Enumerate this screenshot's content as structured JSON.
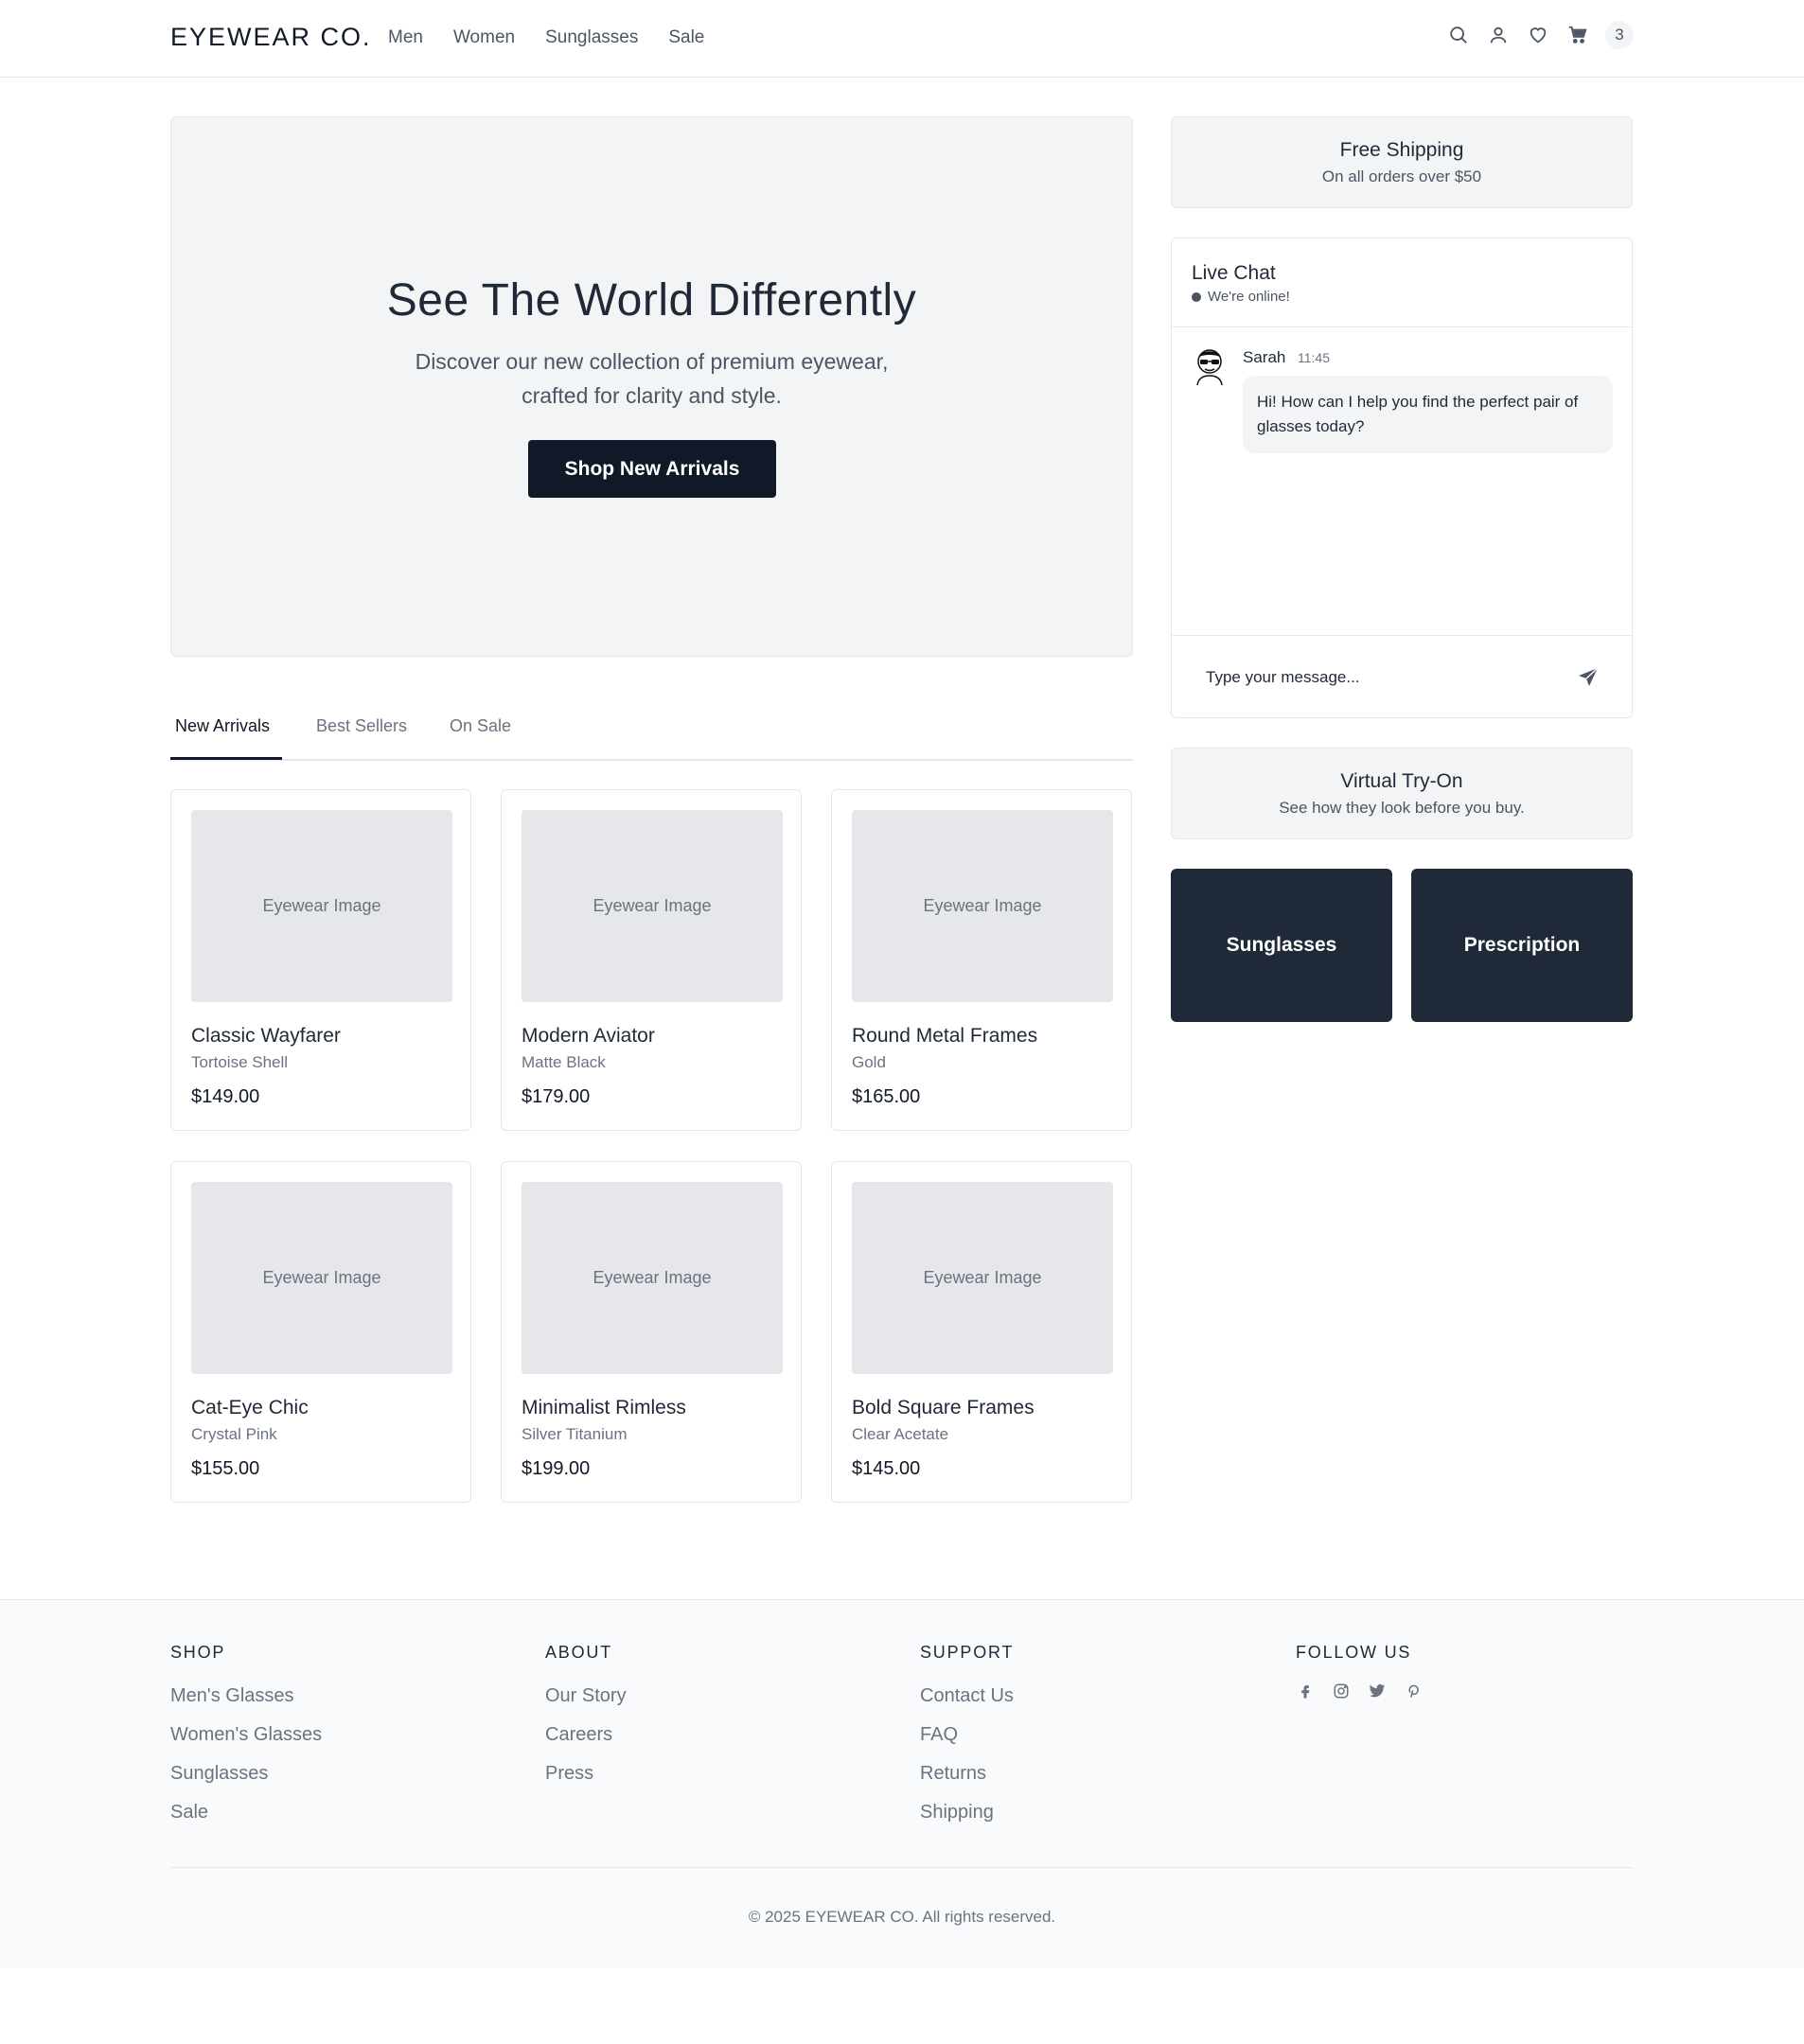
{
  "brand": "EYEWEAR CO.",
  "nav": [
    "Men",
    "Women",
    "Sunglasses",
    "Sale"
  ],
  "header_icons": [
    "search-icon",
    "user-icon",
    "heart-icon",
    "cart-icon"
  ],
  "cart_count": "3",
  "hero": {
    "title": "See The World Differently",
    "subtitle_line1": "Discover our new collection of premium eyewear,",
    "subtitle_line2": "crafted for clarity and style.",
    "cta": "Shop New Arrivals"
  },
  "tabs": [
    "New Arrivals",
    "Best Sellers",
    "On Sale"
  ],
  "active_tab": "New Arrivals",
  "products": [
    {
      "image_label": "Eyewear Image",
      "name": "Classic Wayfarer",
      "variant": "Tortoise Shell",
      "price": "$149.00"
    },
    {
      "image_label": "Eyewear Image",
      "name": "Modern Aviator",
      "variant": "Matte Black",
      "price": "$179.00"
    },
    {
      "image_label": "Eyewear Image",
      "name": "Round Metal Frames",
      "variant": "Gold",
      "price": "$165.00"
    },
    {
      "image_label": "Eyewear Image",
      "name": "Cat-Eye Chic",
      "variant": "Crystal Pink",
      "price": "$155.00"
    },
    {
      "image_label": "Eyewear Image",
      "name": "Minimalist Rimless",
      "variant": "Silver Titanium",
      "price": "$199.00"
    },
    {
      "image_label": "Eyewear Image",
      "name": "Bold Square Frames",
      "variant": "Clear Acetate",
      "price": "$145.00"
    }
  ],
  "free_shipping": {
    "title": "Free Shipping",
    "subtitle": "On all orders over $50"
  },
  "live_chat": {
    "title": "Live Chat",
    "status": "We're online!",
    "message": {
      "sender": "Sarah",
      "time": "11:45 AM",
      "text": "Hi! How can I help you find the perfect pair of glasses today?"
    },
    "input_placeholder": "Type your message..."
  },
  "virtual_tryon": {
    "title": "Virtual Try-On",
    "subtitle": "See how they look before you buy."
  },
  "categories": [
    "Sunglasses",
    "Prescription"
  ],
  "footer": {
    "columns": [
      {
        "heading": "SHOP",
        "links": [
          "Men's Glasses",
          "Women's Glasses",
          "Sunglasses",
          "Sale"
        ]
      },
      {
        "heading": "ABOUT",
        "links": [
          "Our Story",
          "Careers",
          "Press"
        ]
      },
      {
        "heading": "SUPPORT",
        "links": [
          "Contact Us",
          "FAQ",
          "Returns",
          "Shipping"
        ]
      }
    ],
    "follow_heading": "FOLLOW US",
    "social_icons": [
      "facebook-icon",
      "instagram-icon",
      "twitter-icon",
      "pinterest-icon"
    ],
    "copyright": "© 2025 EYEWEAR CO. All rights reserved."
  },
  "colors": {
    "primary_dark": "#111827",
    "tile_dark": "#1f2937",
    "panel_gray": "#f3f4f6",
    "placeholder_gray": "#e5e7eb"
  }
}
